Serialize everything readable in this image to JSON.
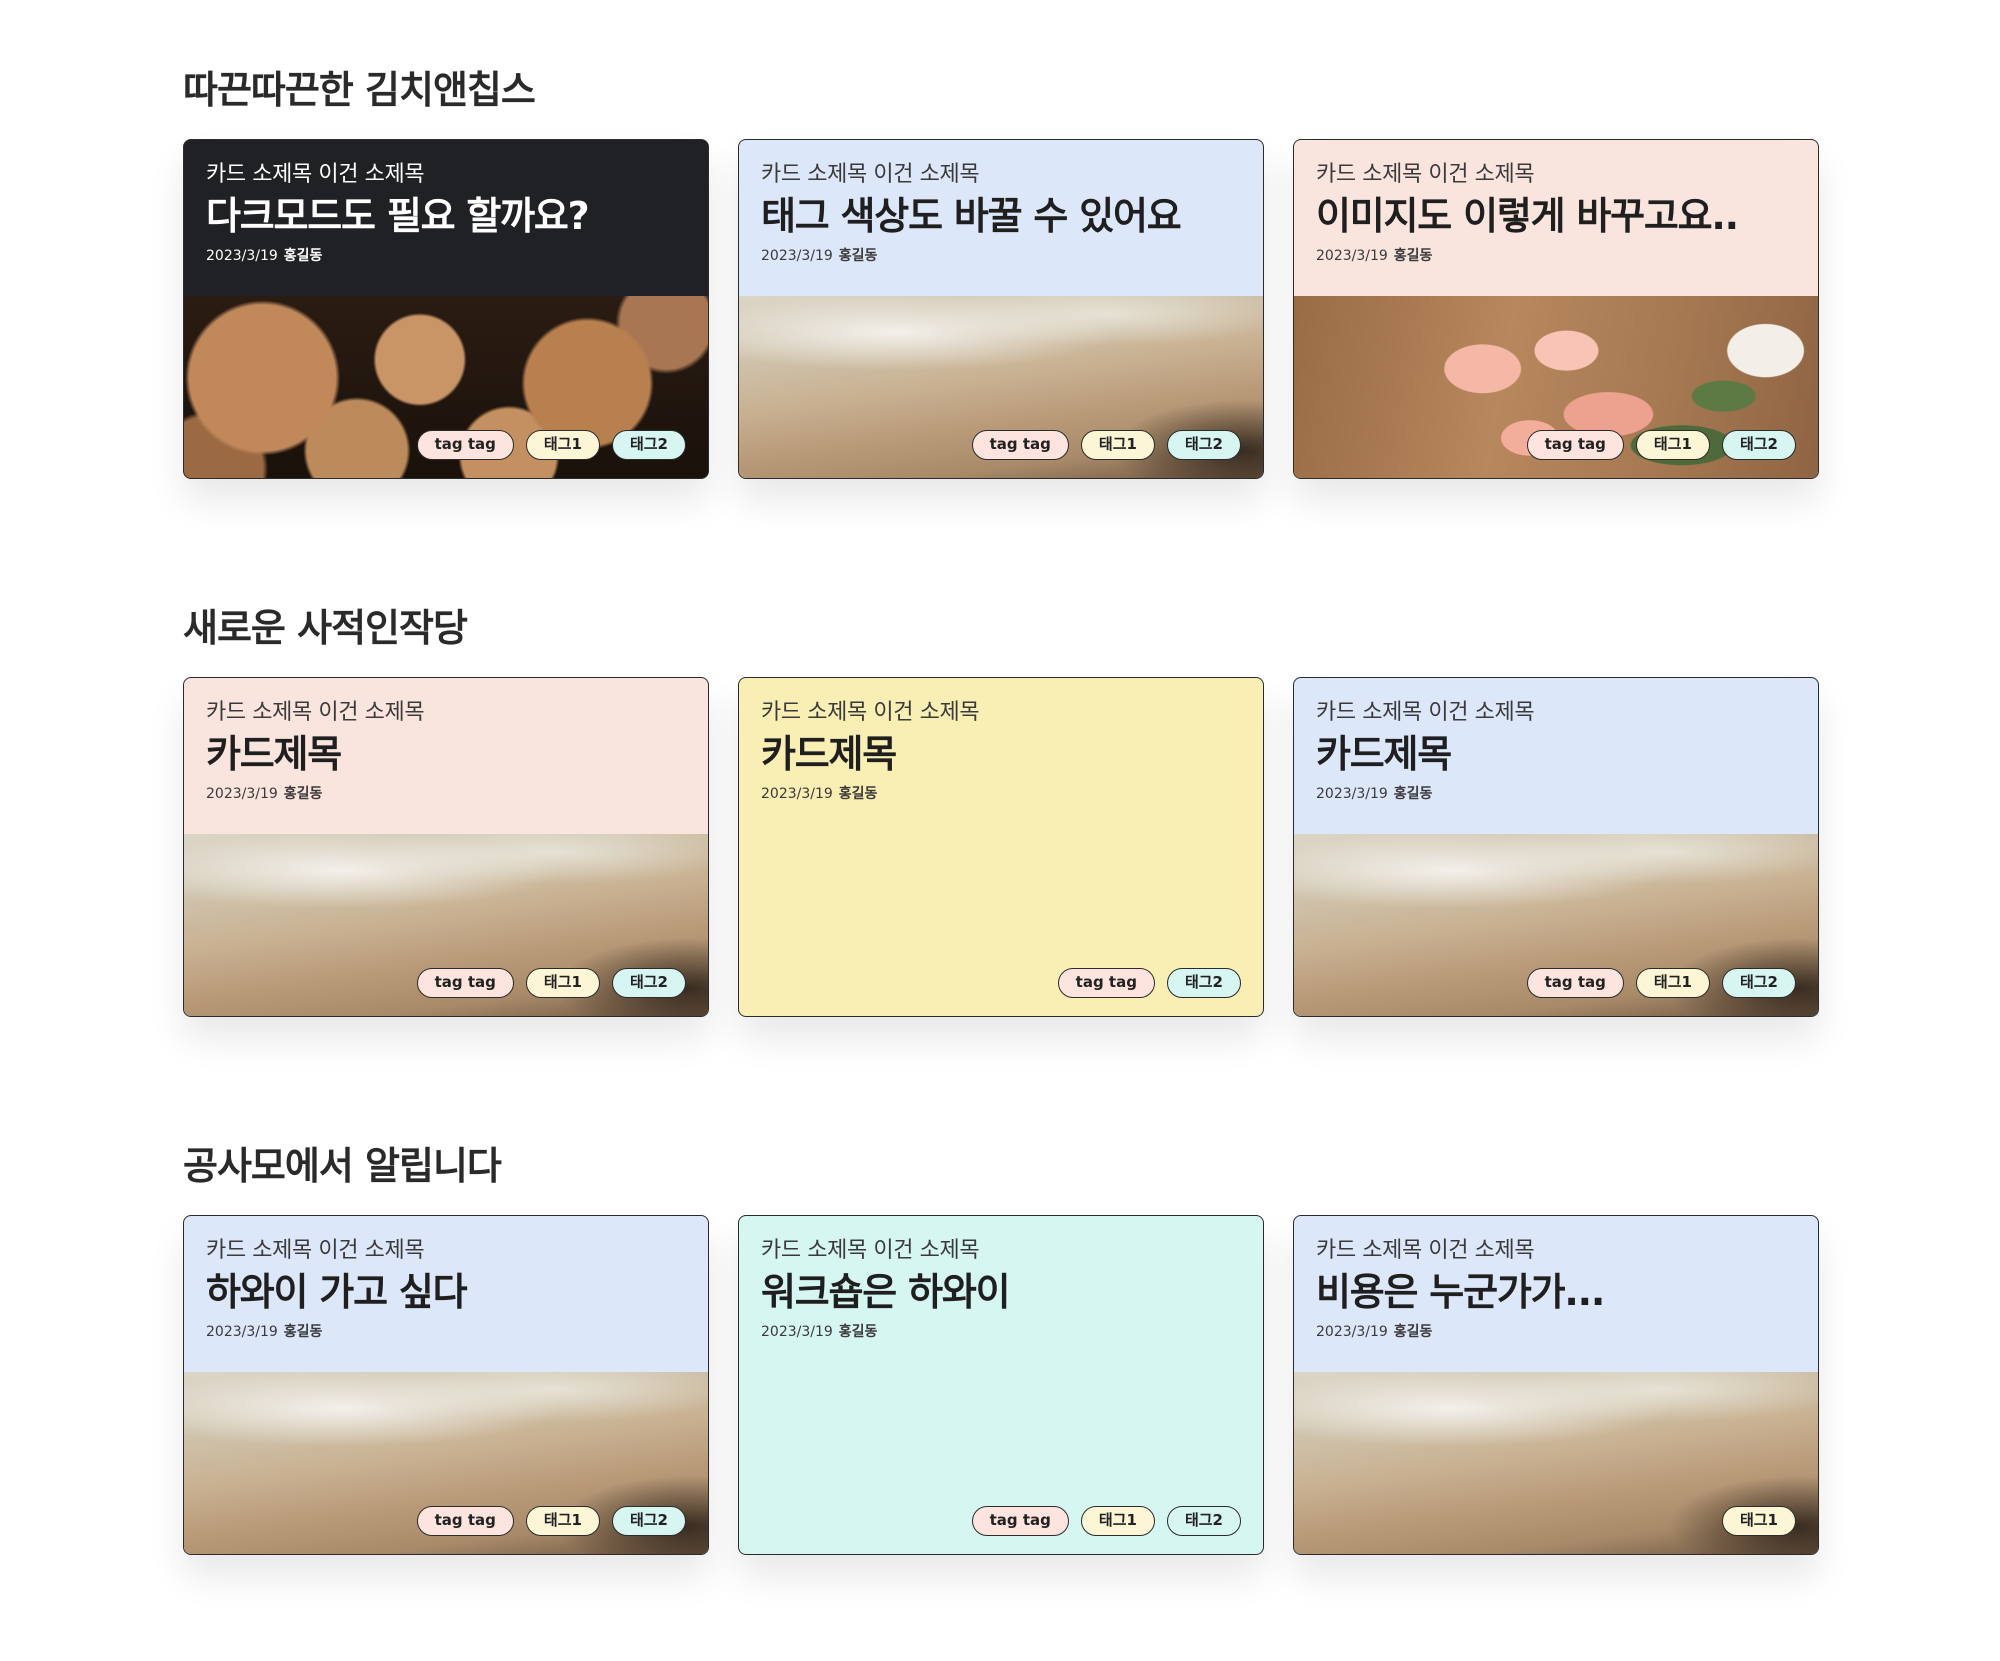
{
  "sections": [
    {
      "title": "따끈따끈한 김치앤칩스",
      "cards": [
        {
          "subtitle": "카드 소제목 이건 소제목",
          "title": "다크모드도 필요 할까요?",
          "date": "2023/3/19",
          "author": "홍길동",
          "bg": "#1f2125",
          "image": "wood",
          "tags": [
            "tag tag",
            "태그1",
            "태그2"
          ]
        },
        {
          "subtitle": "카드 소제목 이건 소제목",
          "title": "태그 색상도 바꿀 수 있어요",
          "date": "2023/3/19",
          "author": "홍길동",
          "bg": "#dde7fa",
          "image": "beach",
          "tags": [
            "tag tag",
            "태그1",
            "태그2"
          ]
        },
        {
          "subtitle": "카드 소제목 이건 소제목",
          "title": "이미지도 이렇게 바꾸고요..",
          "date": "2023/3/19",
          "author": "홍길동",
          "bg": "#fae5de",
          "image": "flower",
          "tags": [
            "tag tag",
            "태그1",
            "태그2"
          ]
        }
      ]
    },
    {
      "title": "새로운 사적인작당",
      "cards": [
        {
          "subtitle": "카드 소제목 이건 소제목",
          "title": "카드제목",
          "date": "2023/3/19",
          "author": "홍길동",
          "bg": "#fae5de",
          "image": "beach",
          "tags": [
            "tag tag",
            "태그1",
            "태그2"
          ]
        },
        {
          "subtitle": "카드 소제목 이건 소제목",
          "title": "카드제목",
          "date": "2023/3/19",
          "author": "홍길동",
          "bg": "#f9eeb3",
          "image": "none",
          "tags": [
            "tag tag",
            "태그2"
          ]
        },
        {
          "subtitle": "카드 소제목 이건 소제목",
          "title": "카드제목",
          "date": "2023/3/19",
          "author": "홍길동",
          "bg": "#dde7fa",
          "image": "beach",
          "tags": [
            "tag tag",
            "태그1",
            "태그2"
          ]
        }
      ]
    },
    {
      "title": "공사모에서 알립니다",
      "cards": [
        {
          "subtitle": "카드 소제목 이건 소제목",
          "title": "하와이 가고 싶다",
          "date": "2023/3/19",
          "author": "홍길동",
          "bg": "#dde7fa",
          "image": "beach",
          "tags": [
            "tag tag",
            "태그1",
            "태그2"
          ]
        },
        {
          "subtitle": "카드 소제목 이건 소제목",
          "title": "워크숍은 하와이",
          "date": "2023/3/19",
          "author": "홍길동",
          "bg": "#d6f6f2",
          "image": "none",
          "tags": [
            "tag tag",
            "태그1",
            "태그2"
          ]
        },
        {
          "subtitle": "카드 소제목 이건 소제목",
          "title": "비용은 누군가가...",
          "date": "2023/3/19",
          "author": "홍길동",
          "bg": "#dde7fa",
          "image": "beach",
          "tags": [
            "태그1"
          ]
        }
      ]
    }
  ],
  "tag_colors": {
    "tag tag": "#fde4df",
    "태그1": "#fdf6d6",
    "태그2": "#d7f6f2"
  }
}
